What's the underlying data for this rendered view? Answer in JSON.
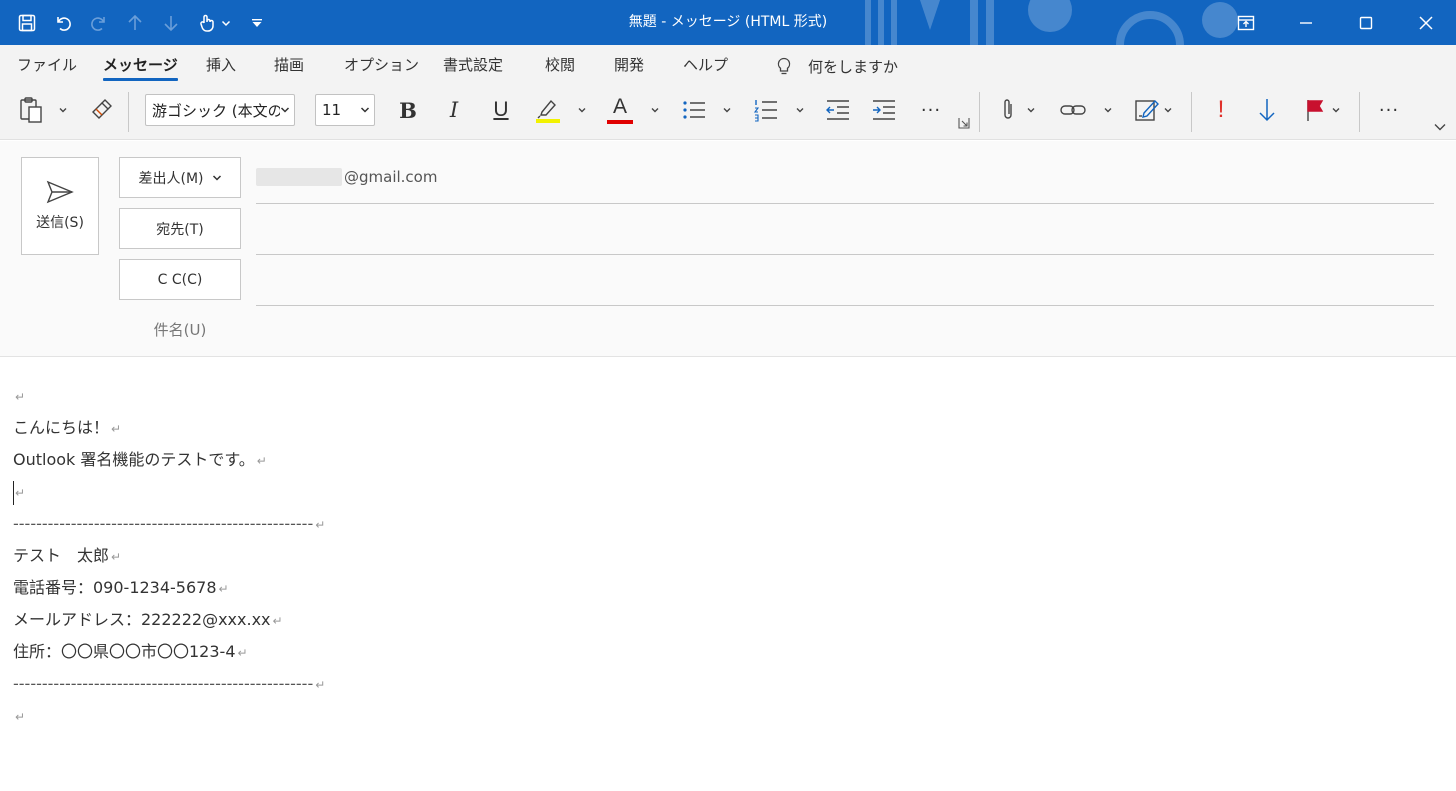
{
  "window": {
    "title": "無題 - メッセージ (HTML 形式)"
  },
  "quick_access": [
    "save-icon",
    "undo-icon",
    "redo-icon",
    "arrow-up-icon",
    "arrow-down-icon",
    "touch-mode-icon",
    "customize-icon"
  ],
  "menu": {
    "tabs": [
      "ファイル",
      "メッセージ",
      "挿入",
      "描画",
      "オプション",
      "書式設定",
      "校閲",
      "開発",
      "ヘルプ"
    ],
    "active_tab": "メッセージ",
    "tell_me": "何をしますか"
  },
  "ribbon": {
    "font_name": "游ゴシック (本文の",
    "font_size": "11",
    "bold": "B",
    "italic": "I",
    "underline": "U",
    "font_color_letter": "A",
    "more": "···",
    "highlight_color": "#f2f200",
    "font_color": "#e00000",
    "importance_high": "!",
    "flag_color": "#c8102e"
  },
  "compose": {
    "send_label": "送信(S)",
    "from_label": "差出人(M)",
    "from_value": "@gmail.com",
    "to_label": "宛先(T)",
    "cc_label": "C C(C)",
    "subject_label": "件名(U)"
  },
  "body": {
    "lines": [
      "",
      "こんにちは！",
      "Outlook 署名機能のテストです。",
      "",
      "----------------------------------------------------",
      "テスト　太郎",
      "電話番号：090-1234-5678",
      "メールアドレス：222222@xxx.xx",
      "住所：〇〇県〇〇市〇〇123-4",
      "----------------------------------------------------",
      ""
    ],
    "return_mark": "↵"
  },
  "colors": {
    "titlebar": "#1265c0",
    "accent": "#1265c0"
  }
}
